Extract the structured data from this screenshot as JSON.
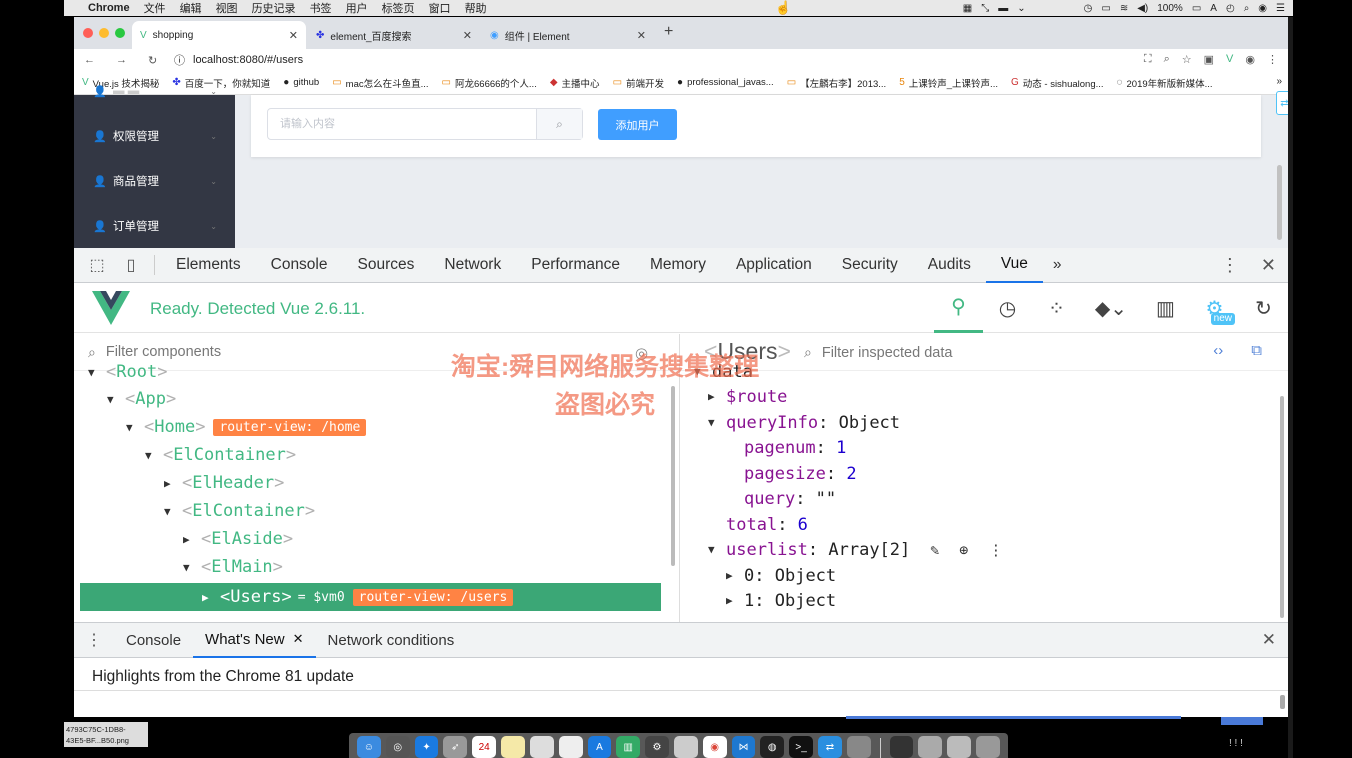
{
  "menubar": {
    "items": [
      "Chrome",
      "文件",
      "编辑",
      "视图",
      "历史记录",
      "书签",
      "用户",
      "标签页",
      "窗口",
      "帮助"
    ],
    "battery": "100%"
  },
  "browser": {
    "tabs": [
      {
        "title": "shopping",
        "fav": "V"
      },
      {
        "title": "element_百度搜索",
        "fav": "✤"
      },
      {
        "title": "组件 | Element",
        "fav": "◉"
      }
    ],
    "url": "localhost:8080/#/users",
    "bookmarks": [
      {
        "icon": "V",
        "label": "Vue.js 技术揭秘"
      },
      {
        "icon": "✤",
        "label": "百度一下，你就知道"
      },
      {
        "icon": "●",
        "label": "github"
      },
      {
        "icon": "▭",
        "label": "mac怎么在斗鱼直..."
      },
      {
        "icon": "▭",
        "label": "阿龙66666的个人..."
      },
      {
        "icon": "◆",
        "label": "主播中心"
      },
      {
        "icon": "▭",
        "label": "前端开发"
      },
      {
        "icon": "●",
        "label": "professional_javas..."
      },
      {
        "icon": "▭",
        "label": "【左麟右李】2013..."
      },
      {
        "icon": "5",
        "label": "上课铃声_上课铃声..."
      },
      {
        "icon": "G",
        "label": "动态 - sishualong..."
      },
      {
        "icon": "◌",
        "label": "2019年新版新媒体..."
      }
    ]
  },
  "app": {
    "sidebar": [
      {
        "label": "权限管理"
      },
      {
        "label": "商品管理"
      },
      {
        "label": "订单管理"
      }
    ],
    "search_placeholder": "请输入内容",
    "add_button": "添加用户"
  },
  "devtools": {
    "tabs": [
      "Elements",
      "Console",
      "Sources",
      "Network",
      "Performance",
      "Memory",
      "Application",
      "Security",
      "Audits",
      "Vue"
    ],
    "active_tab": "Vue",
    "vue": {
      "status": "Ready. Detected Vue 2.6.11.",
      "new_badge": "new",
      "filter_components_placeholder": "Filter components",
      "filter_data_placeholder": "Filter inspected data",
      "selected_component": "Users",
      "tree": [
        {
          "name": "Root",
          "toggle": "▼",
          "badge": null
        },
        {
          "name": "App",
          "toggle": "▼",
          "badge": null
        },
        {
          "name": "Home",
          "toggle": "▼",
          "badge": "router-view: /home"
        },
        {
          "name": "ElContainer",
          "toggle": "▼",
          "badge": null
        },
        {
          "name": "ElHeader",
          "toggle": "▶",
          "badge": null
        },
        {
          "name": "ElContainer",
          "toggle": "▼",
          "badge": null
        },
        {
          "name": "ElAside",
          "toggle": "▶",
          "badge": null
        },
        {
          "name": "ElMain",
          "toggle": "▼",
          "badge": null
        },
        {
          "name": "Users",
          "toggle": "▶",
          "badge": "router-view: /users",
          "vm": "= $vm0"
        }
      ],
      "data": {
        "section": "data",
        "route": "$route",
        "queryInfo_key": "queryInfo",
        "queryInfo_val": "Object",
        "pagenum_key": "pagenum",
        "pagenum_val": "1",
        "pagesize_key": "pagesize",
        "pagesize_val": "2",
        "query_key": "query",
        "query_val": "\"\"",
        "total_key": "total",
        "total_val": "6",
        "userlist_key": "userlist",
        "userlist_val": "Array[2]",
        "item0_key": "0",
        "item0_val": "Object",
        "item1_key": "1",
        "item1_val": "Object"
      }
    },
    "drawer": {
      "tabs": [
        "Console",
        "What's New",
        "Network conditions"
      ],
      "active": "What's New",
      "highlight": "Highlights from the Chrome 81 update"
    }
  },
  "overlay": {
    "watermark_line1": "淘宝:舜目网络服务搜集整理",
    "watermark_line2": "盗图必究",
    "thumb_label_1": "4793C75C-1DB8-",
    "thumb_label_2": "43E5-BF...B50.png",
    "dock_date": "24"
  },
  "colors": {
    "vue_green": "#42b883",
    "element_blue": "#409eff",
    "sidebar": "#333744",
    "badge_orange": "#ff8344"
  }
}
